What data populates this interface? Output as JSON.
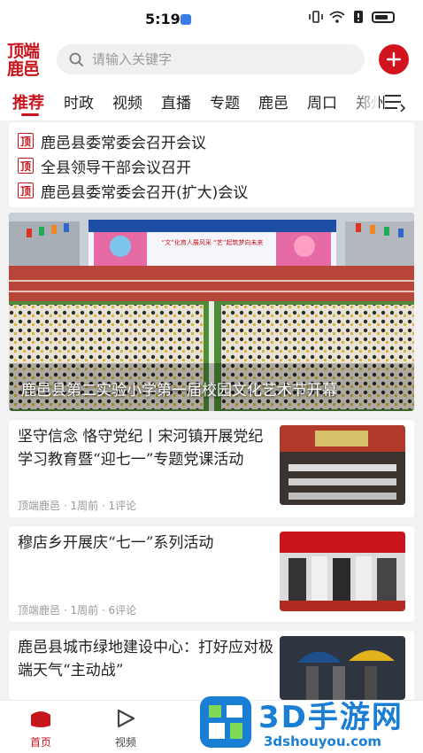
{
  "status_bar": {
    "time": "5:19"
  },
  "header": {
    "logo_line1": "顶端",
    "logo_line2": "鹿邑",
    "search_placeholder": "请输入关键字"
  },
  "tabs": [
    {
      "label": "推荐",
      "active": true
    },
    {
      "label": "时政"
    },
    {
      "label": "视频"
    },
    {
      "label": "直播"
    },
    {
      "label": "专题"
    },
    {
      "label": "鹿邑"
    },
    {
      "label": "周口"
    },
    {
      "label": "郑州"
    }
  ],
  "headlines": [
    {
      "badge": "顶",
      "text": "鹿邑县委常委会召开会议"
    },
    {
      "badge": "顶",
      "text": "全县领导干部会议召开"
    },
    {
      "badge": "顶",
      "text": "鹿邑县委常委会召开(扩大)会议"
    }
  ],
  "banner": {
    "caption": "鹿邑县第二实验小学第一届校园文化艺术节开幕",
    "stage_text": "“文”化育人展风采 “艺”起筑梦向未来"
  },
  "news": [
    {
      "title": "坚守信念 恪守党纪丨宋河镇开展党纪学习教育暨“迎七一”专题党课活动",
      "source": "顶端鹿邑",
      "time": "1周前",
      "comments": "1评论",
      "meta": "顶端鹿邑 · 1周前 · 1评论"
    },
    {
      "title": "穆店乡开展庆“七一”系列活动",
      "source": "顶端鹿邑",
      "time": "1周前",
      "comments": "6评论",
      "meta": "顶端鹿邑 · 1周前 · 6评论"
    },
    {
      "title": "鹿邑县城市绿地建设中心：打好应对极端天气“主动战”",
      "source": "",
      "time": "",
      "comments": "",
      "meta": ""
    }
  ],
  "bottom_nav": [
    {
      "label": "首页",
      "icon": "home-icon",
      "active": true
    },
    {
      "label": "视频",
      "icon": "play-icon"
    }
  ],
  "watermark": {
    "title": "3D手游网",
    "url": "3dshouyou.com"
  },
  "colors": {
    "brand_red": "#c8151d",
    "accent_blue": "#1a7fd4"
  }
}
